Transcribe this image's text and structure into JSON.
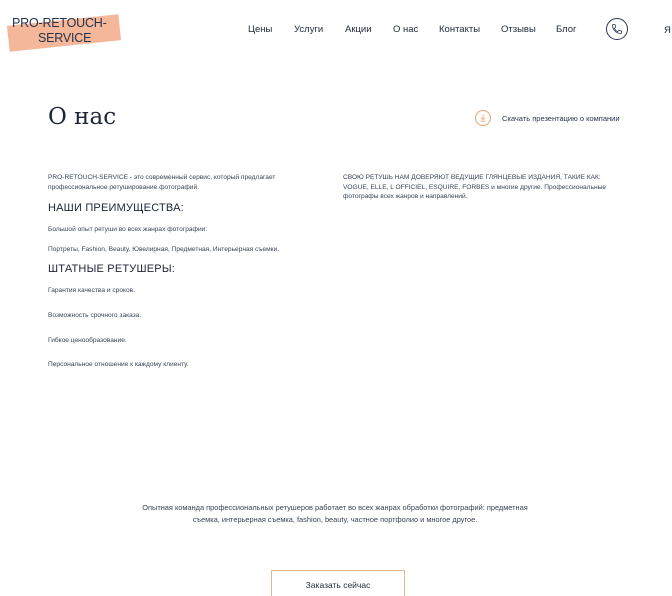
{
  "logo": {
    "line1": "PRO-RETOUCH-",
    "line2": "SERVICE",
    "accent_color": "#f4b79a"
  },
  "nav": {
    "items": [
      {
        "label": "Цены"
      },
      {
        "label": "Услуги"
      },
      {
        "label": "Акции"
      },
      {
        "label": "О нас"
      },
      {
        "label": "Контакты"
      },
      {
        "label": "Отзывы"
      },
      {
        "label": "Блог"
      }
    ],
    "phone_icon": "phone-icon",
    "lang_label": "Я"
  },
  "page": {
    "title": "О нас",
    "download_label": "Скачать презентацию о компании",
    "download_icon": "download-icon"
  },
  "left": {
    "intro": "PRO-RETOUCH-SERVICE - это современный сервис, который предлагает профессиональное ретуширование фотографий.",
    "advantages_heading": "НАШИ ПРЕИМУЩЕСТВА:",
    "advantages": [
      "Большой опыт ретуши во всех жанрах фотографии:",
      "Портреты, Fashion, Beauty, Ювелирная, Предметная, Интерьерная съемки."
    ],
    "staff_heading": "ШТАТНЫЕ РЕТУШЕРЫ:",
    "staff": [
      "Гарантия качества и сроков.",
      "Возможность срочного заказа.",
      "Гибкое ценообразование.",
      "Персональное отношение к каждому клиенту."
    ]
  },
  "right": {
    "text": "СВОЮ РЕТУШЬ НАМ ДОВЕРЯЮТ ВЕДУЩИЕ ГЛЯНЦЕВЫЕ ИЗДАНИЯ, ТАКИЕ КАК: VOGUE, ELLE, L OFFICIEL, ESQUIRE, FORBES и многие другие. Профессиональные фотографы всех жанров и направлений."
  },
  "bottom": {
    "text": "Опытная команда профессиональных ретушеров работает во всех жанрах обработки фотографий: предметная съемка, интерьерная съемка, fashion, beauty, частное портфолио и многое другое.",
    "order_button": "Заказать сейчас",
    "button_border_color": "#e0b98e"
  }
}
